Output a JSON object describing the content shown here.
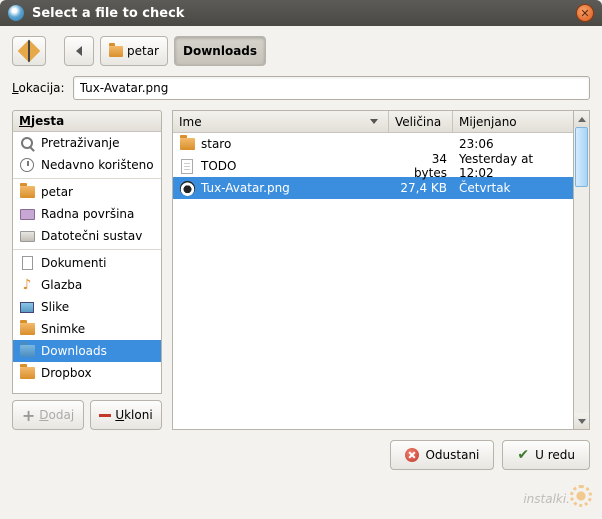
{
  "window": {
    "title": "Select a file to check"
  },
  "toolbar": {
    "breadcrumb": {
      "parent": "petar",
      "current": "Downloads"
    }
  },
  "location": {
    "label_pre": "L",
    "label_post": "okacija:",
    "value": "Tux-Avatar.png"
  },
  "places": {
    "header_pre": "M",
    "header_post": "jesta",
    "items": [
      {
        "icon": "search",
        "label": "Pretraživanje"
      },
      {
        "icon": "clock",
        "label": "Nedavno korišteno"
      },
      {
        "sep": true
      },
      {
        "icon": "folder",
        "label": "petar"
      },
      {
        "icon": "desktop",
        "label": "Radna površina"
      },
      {
        "icon": "drive",
        "label": "Datotečni sustav"
      },
      {
        "sep": true
      },
      {
        "icon": "doc",
        "label": "Dokumenti"
      },
      {
        "icon": "music",
        "label": "Glazba"
      },
      {
        "icon": "pic",
        "label": "Slike"
      },
      {
        "icon": "folder",
        "label": "Snimke"
      },
      {
        "icon": "dl",
        "label": "Downloads",
        "selected": true
      },
      {
        "icon": "folder",
        "label": "Dropbox"
      }
    ],
    "add_pre": "D",
    "add_post": "odaj",
    "remove_pre": "U",
    "remove_post": "kloni"
  },
  "files": {
    "cols": {
      "name": "Ime",
      "size": "Veličina",
      "modified": "Mijenjano"
    },
    "rows": [
      {
        "icon": "folder",
        "name": "staro",
        "size": "",
        "modified": "23:06"
      },
      {
        "icon": "txt",
        "name": "TODO",
        "size": "34 bytes",
        "modified": "Yesterday at 12:02"
      },
      {
        "icon": "png",
        "name": "Tux-Avatar.png",
        "size": "27,4 KB",
        "modified": "Četvrtak",
        "selected": true
      }
    ]
  },
  "buttons": {
    "cancel": "Odustani",
    "ok": "U redu"
  },
  "watermark": "instalki."
}
